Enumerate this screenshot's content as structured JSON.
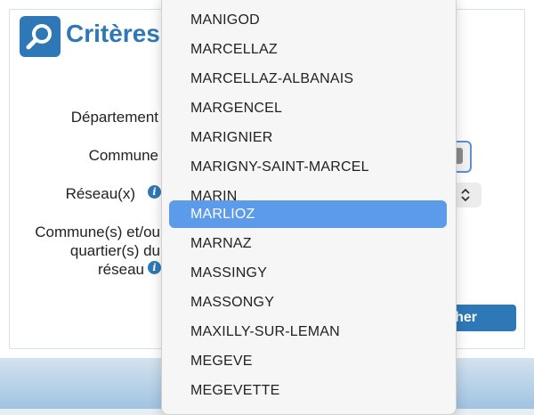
{
  "page": {
    "title": "Critères d"
  },
  "form": {
    "departement_label": "Département",
    "commune_label": "Commune",
    "reseau_label": "Réseau(x)",
    "communes_label_line1": "Commune(s) et/ou",
    "communes_label_line2": "quartier(s) du",
    "communes_label_line3": "réseau",
    "search_button_label": "her"
  },
  "dropdown": {
    "options": [
      "MANIGOD",
      "MARCELLAZ",
      "MARCELLAZ-ALBANAIS",
      "MARGENCEL",
      "MARIGNIER",
      "MARIGNY-SAINT-MARCEL",
      "MARIN",
      "MARLIOZ",
      "MARNAZ",
      "MASSINGY",
      "MASSONGY",
      "MAXILLY-SUR-LEMAN",
      "MEGEVE",
      "MEGEVETTE"
    ],
    "selected": "MARLIOZ"
  },
  "colors": {
    "brand": "#2f78b7",
    "selection": "#5b9bea"
  },
  "icons": {
    "title": "magnifier-icon",
    "info": "info-icon",
    "select": "chevron-up-down-icon"
  }
}
